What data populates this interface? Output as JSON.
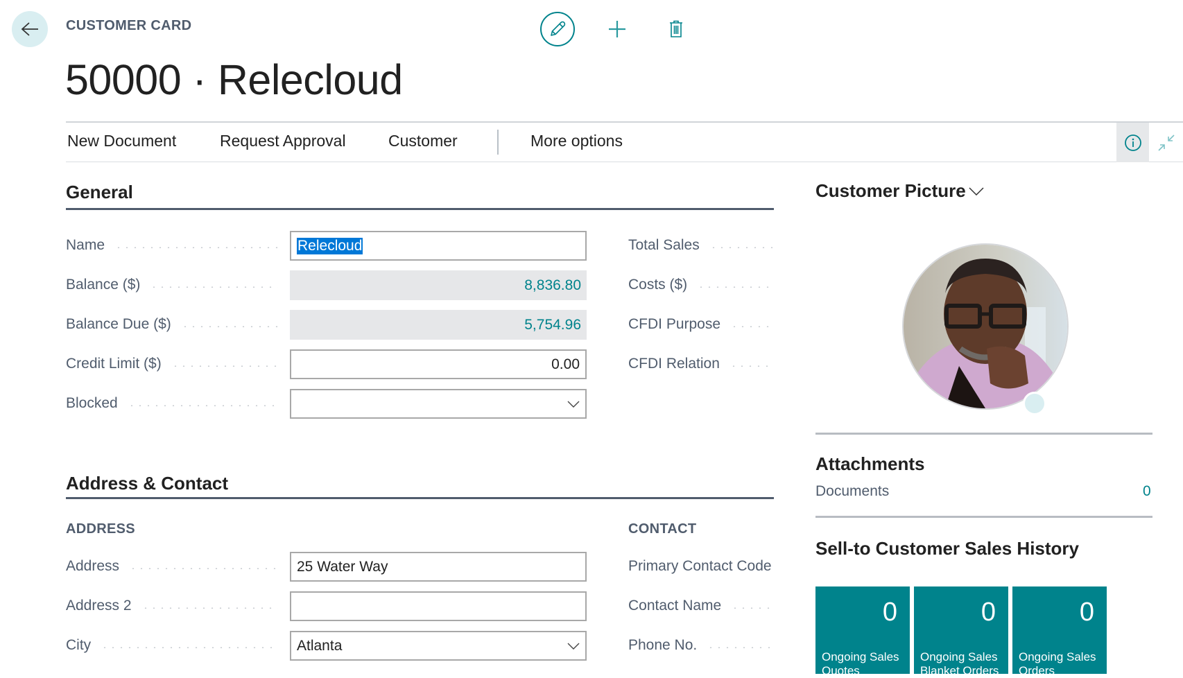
{
  "header": {
    "caption": "CUSTOMER CARD",
    "title": "50000 · Relecloud",
    "icons": [
      "back-arrow-icon",
      "pencil-icon",
      "plus-icon",
      "trash-icon"
    ]
  },
  "action_bar": {
    "items": [
      "New Document",
      "Request Approval",
      "Customer",
      "More options"
    ],
    "right_icons": [
      "info-icon",
      "collapse-icon"
    ]
  },
  "general": {
    "title": "General",
    "left_fields": [
      {
        "label": "Name",
        "value": "Relecloud",
        "type": "text",
        "selected": true
      },
      {
        "label": "Balance ($)",
        "value": "8,836.80",
        "type": "readonly"
      },
      {
        "label": "Balance Due ($)",
        "value": "5,754.96",
        "type": "readonly"
      },
      {
        "label": "Credit Limit ($)",
        "value": "0.00",
        "type": "number"
      },
      {
        "label": "Blocked",
        "value": "",
        "type": "select"
      }
    ],
    "right_fields": [
      {
        "label": "Total Sales"
      },
      {
        "label": "Costs ($)"
      },
      {
        "label": "CFDI Purpose"
      },
      {
        "label": "CFDI Relation"
      }
    ]
  },
  "address_contact": {
    "title": "Address & Contact",
    "address_heading": "ADDRESS",
    "contact_heading": "CONTACT",
    "address_fields": [
      {
        "label": "Address",
        "value": "25 Water Way",
        "type": "text"
      },
      {
        "label": "Address 2",
        "value": "",
        "type": "text"
      },
      {
        "label": "City",
        "value": "Atlanta",
        "type": "select"
      }
    ],
    "contact_fields": [
      {
        "label": "Primary Contact Code"
      },
      {
        "label": "Contact Name"
      },
      {
        "label": "Phone No."
      }
    ]
  },
  "factbox": {
    "picture_title": "Customer Picture",
    "attachments_title": "Attachments",
    "documents_label": "Documents",
    "documents_count": "0",
    "sales_history_title": "Sell-to Customer Sales History",
    "tiles": [
      {
        "value": "0",
        "label": "Ongoing Sales Quotes"
      },
      {
        "value": "0",
        "label": "Ongoing Sales Blanket Orders"
      },
      {
        "value": "0",
        "label": "Ongoing Sales Orders"
      }
    ],
    "tile_color": "#00838c"
  },
  "colors": {
    "accent": "#00838c",
    "label": "#505c6d",
    "selection": "#0078d7",
    "readonly_bg": "#e6e7e9"
  }
}
